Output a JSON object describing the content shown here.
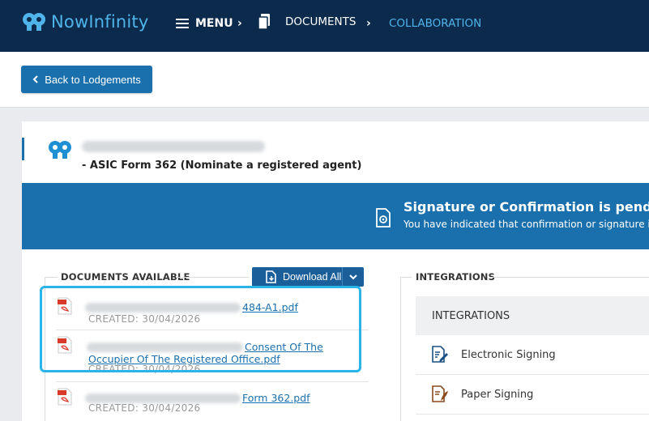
{
  "app": {
    "logo_text": "NowInfinity"
  },
  "nav": {
    "menu": "MENU",
    "documents": "DOCUMENTS",
    "collaboration": "COLLABORATION",
    "separator": "›"
  },
  "toolbar": {
    "back_label": "Back to Lodgements"
  },
  "lodgement": {
    "form_title": "- ASIC Form 362 (Nominate a registered agent)"
  },
  "banner": {
    "title": "Signature or Confirmation is pending",
    "subtitle": "You have indicated that confirmation or signature is r"
  },
  "documents": {
    "section_label": "DOCUMENTS AVAILABLE",
    "download_all_label": "Download All",
    "items": [
      {
        "name_line1": "484-A1.pdf",
        "name_line2": "",
        "created": "CREATED: 30/04/2026"
      },
      {
        "name_line1": "Consent Of The",
        "name_line2": "Occupier Of The Registered Office.pdf",
        "created": "CREATED: 30/04/2026"
      },
      {
        "name_line1": "Form 362.pdf",
        "name_line2": "",
        "created": "CREATED: 30/04/2026"
      }
    ]
  },
  "integrations": {
    "section_label": "INTEGRATIONS",
    "header": "INTEGRATIONS",
    "items": [
      {
        "label": "Electronic Signing",
        "icon": "e-sign-icon"
      },
      {
        "label": "Paper Signing",
        "icon": "paper-sign-icon"
      }
    ]
  },
  "colors": {
    "topbar": "#0c2a4b",
    "accent": "#1a6fad",
    "logo": "#4fb4ea",
    "highlight": "#2ab4ea"
  }
}
